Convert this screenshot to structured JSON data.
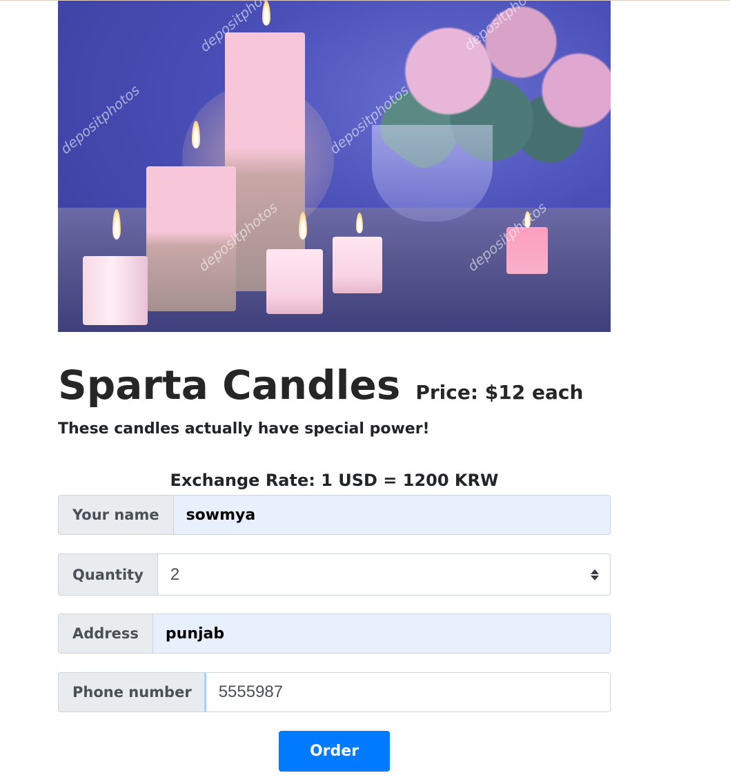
{
  "hero": {
    "watermark_text": "depositphotos"
  },
  "product": {
    "title": "Sparta Candles",
    "price": "Price: $12 each",
    "tagline": "These candles actually have special power!"
  },
  "exchange_rate": "Exchange Rate: 1 USD = 1200 KRW",
  "form": {
    "name": {
      "label": "Your name",
      "value": "sowmya"
    },
    "quantity": {
      "label": "Quantity",
      "value": "2"
    },
    "address": {
      "label": "Address",
      "value": "punjab"
    },
    "phone": {
      "label": "Phone number",
      "value": "5555987"
    },
    "order_button": "Order"
  },
  "colors": {
    "button": "#007bff",
    "autofill_bg": "#e8f0fe",
    "addon_bg": "#e9ecef"
  }
}
